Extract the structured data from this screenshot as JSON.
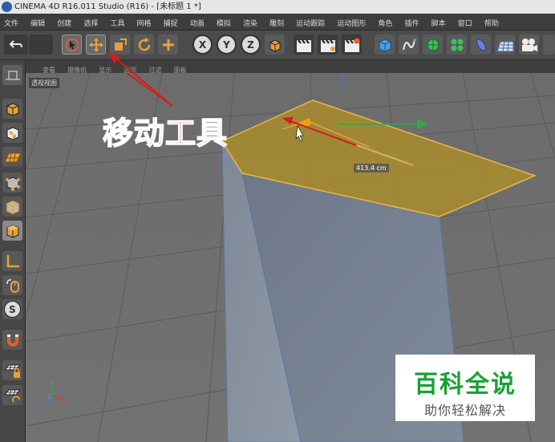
{
  "window": {
    "title": "CINEMA 4D R16.011 Studio (R16) - [未标题 1 *]"
  },
  "menu": [
    "文件",
    "编辑",
    "创建",
    "选择",
    "工具",
    "网格",
    "捕捉",
    "动画",
    "模拟",
    "渲染",
    "雕刻",
    "运动跟踪",
    "运动图形",
    "角色",
    "插件",
    "脚本",
    "窗口",
    "帮助"
  ],
  "toolbar": {
    "x_label": "X",
    "y_label": "Y",
    "z_label": "Z"
  },
  "leftbar": {
    "sculpt_label": "S"
  },
  "viewport_menu": [
    "查看",
    "摄像机",
    "显示",
    "选项",
    "过滤",
    "面板"
  ],
  "viewport": {
    "label": "透视视图",
    "measure": "413.4 cm",
    "axis_x": "X",
    "axis_y": "Y",
    "axis_z": "Z"
  },
  "annotation": {
    "text": "移动工具"
  },
  "watermark": {
    "title": "百科全说",
    "subtitle": "助你轻松解决"
  },
  "colors": {
    "selected_face": "#a48a32",
    "annotation_red": "#d21e1e",
    "tool_orange": "#e8a13a",
    "watermark_green": "#1aa035",
    "viewport_bg": "#6a6a6a"
  }
}
